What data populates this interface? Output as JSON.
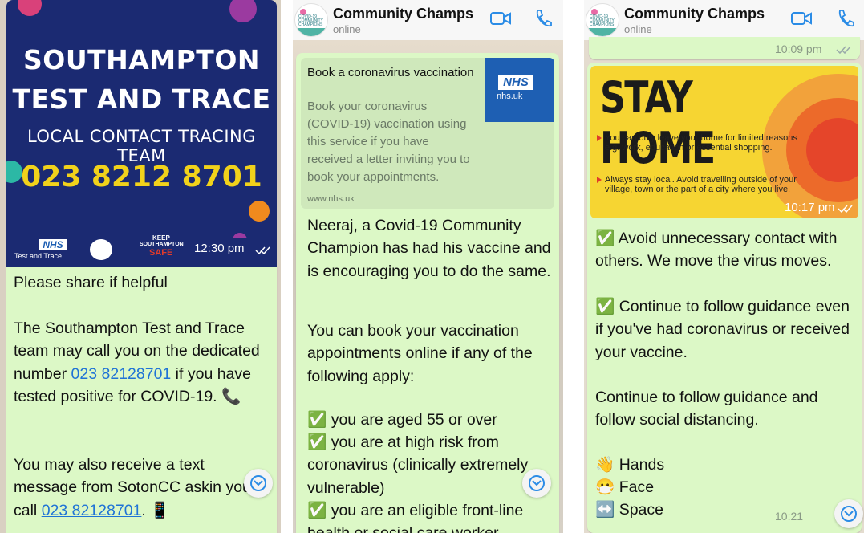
{
  "panel1": {
    "poster": {
      "title_line1": "SOUTHAMPTON",
      "title_line2": "TEST AND TRACE",
      "subtitle": "LOCAL CONTACT TRACING TEAM",
      "phone": "023 8212 8701",
      "footer_nhs": "NHS",
      "footer_nhs_sub": "Test and Trace",
      "footer_keep": "KEEP",
      "footer_southampton": "SOUTHAMPTON",
      "footer_safe": "SAFE",
      "time": "12:30 pm"
    },
    "message": {
      "line1": "Please share if helpful",
      "p2_a": "The Southampton Test and Trace team may call you on the dedicated number ",
      "p2_link": "023 82128701",
      "p2_b": " if you have tested positive for COVID-19. 📞",
      "p3_a": "You may also receive a text message from SotonCC askin",
      "p3_b": "you to call ",
      "p3_link": "023 82128701",
      "p3_c": ". 📱"
    }
  },
  "panel2": {
    "header": {
      "title": "Community Champs",
      "status": "online"
    },
    "preview": {
      "title": "Book a coronavirus vaccination",
      "description": "Book your coronavirus (COVID-19) vaccination using this service if you have received a letter inviting you to book your appointments.",
      "url": "www.nhs.uk",
      "logo": "NHS",
      "logo_sub": "nhs.uk"
    },
    "message": {
      "p1": "Neeraj, a Covid-19 Community Champion has had his vaccine and is encouraging you to do the same.",
      "p2": "You can book your vaccination appointments online if any of the following apply:",
      "b1": "✅ you are aged 55 or over",
      "b2": "✅ you are at high risk from coronavirus (clinically extremely vulnerable)",
      "b3": "✅ you are an eligible front-line health or social care worker"
    }
  },
  "panel3": {
    "header": {
      "title": "Community Champs",
      "status": "online"
    },
    "top_time": "10:09 pm",
    "stayhome": {
      "heading": "STAY HOME",
      "rule1": "You can only leave your home for limited reasons e.g. work, education or essential shopping.",
      "rule2": "Always stay local. Avoid travelling outside of your village, town or the part of a city where you live.",
      "time": "10:17 pm"
    },
    "message": {
      "p1": "✅ Avoid unnecessary contact with others. We move the virus moves.",
      "p2": "✅ Continue to follow guidance even if you've had coronavirus or received your vaccine.",
      "p3": "Continue to follow guidance and follow social distancing.",
      "l1": "👋 Hands",
      "l2": "😷 Face",
      "l3": "↔️ Space",
      "time": "10:21 pm"
    }
  },
  "colors": {
    "bubble": "#dcf8c6",
    "link": "#1f73d6",
    "poster": "#1b2a72",
    "phone": "#f1d21b",
    "accent": "#2b8ce6"
  }
}
